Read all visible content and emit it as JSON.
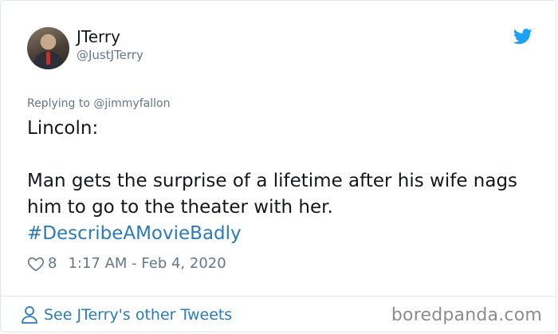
{
  "author": {
    "name": "JTerry",
    "handle": "@JustJTerry"
  },
  "reply": {
    "text": "Replying to @jimmyfallon"
  },
  "tweet": {
    "line1": "Lincoln:",
    "line2": "Man gets the surprise of a lifetime after his wife nags him to go to the theater with her.",
    "hashtag": "#DescribeAMovieBadly"
  },
  "meta": {
    "likes": "8",
    "timestamp": "1:17 AM - Feb 4, 2020"
  },
  "footer": {
    "see_tweets": "See JTerry's other Tweets"
  },
  "watermark": "boredpanda.com",
  "icons": {
    "brand": "twitter-bird-icon",
    "like": "heart-icon",
    "profile": "person-icon"
  },
  "colors": {
    "link": "#2b7bb9",
    "twitter_blue": "#1da1f2",
    "muted": "#657786",
    "text": "#14171a"
  }
}
